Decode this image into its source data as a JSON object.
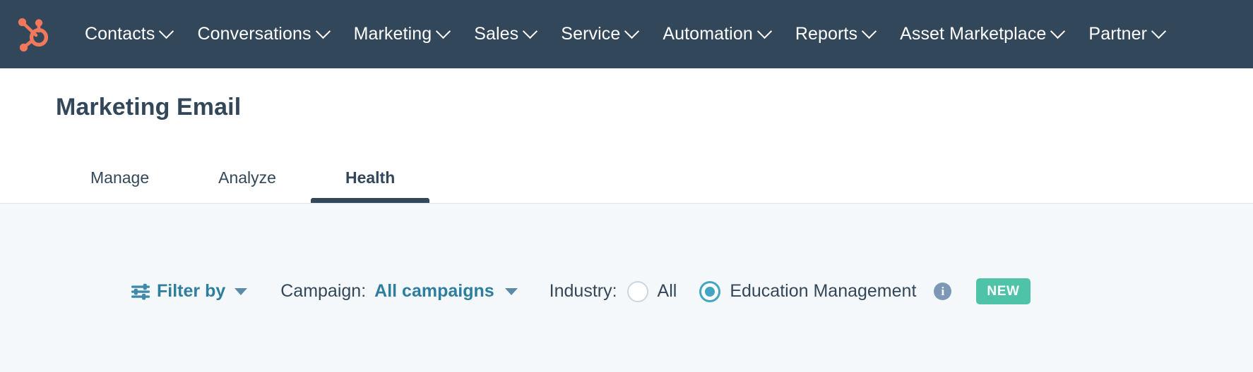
{
  "topnav": {
    "background": "#33475b",
    "logo": {
      "name": "hubspot-sprocket-logo",
      "color": "#f2785c"
    },
    "items": [
      {
        "label": "Contacts",
        "has_dropdown": true
      },
      {
        "label": "Conversations",
        "has_dropdown": true
      },
      {
        "label": "Marketing",
        "has_dropdown": true
      },
      {
        "label": "Sales",
        "has_dropdown": true
      },
      {
        "label": "Service",
        "has_dropdown": true
      },
      {
        "label": "Automation",
        "has_dropdown": true
      },
      {
        "label": "Reports",
        "has_dropdown": true
      },
      {
        "label": "Asset Marketplace",
        "has_dropdown": true
      },
      {
        "label": "Partner",
        "has_dropdown": true
      }
    ]
  },
  "header": {
    "title": "Marketing Email",
    "tabs": [
      {
        "label": "Manage",
        "active": false
      },
      {
        "label": "Analyze",
        "active": false
      },
      {
        "label": "Health",
        "active": true
      }
    ],
    "active_tab_color": "#33475b"
  },
  "filter_bar": {
    "filter_by": {
      "label": "Filter by",
      "icon": "sliders-icon",
      "color": "#2e7e9e"
    },
    "campaign": {
      "label": "Campaign:",
      "value": "All campaigns",
      "value_color": "#2e7e9e"
    },
    "industry": {
      "label": "Industry:",
      "options": [
        {
          "label": "All",
          "selected": false
        },
        {
          "label": "Education Management",
          "selected": true
        }
      ],
      "selected_color": "#43a5c1",
      "info_icon": "info-icon",
      "info_icon_glyph": "i",
      "badge": {
        "label": "NEW",
        "color": "#4ec3a7"
      }
    }
  }
}
